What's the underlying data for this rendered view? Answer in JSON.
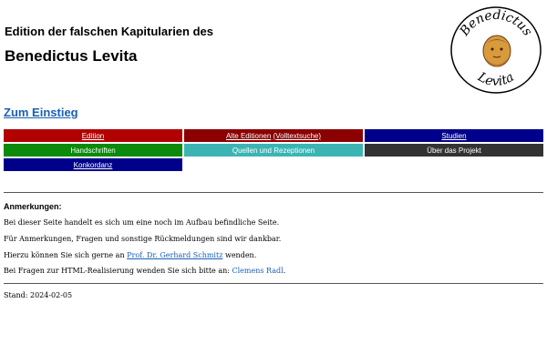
{
  "header": {
    "title_line1": "Edition der falschen Kapitularien des",
    "title_line2": "Benedictus Levita",
    "logo_text_top": "Benedictus",
    "logo_text_bottom": "Levita"
  },
  "entry_link": "Zum Einstieg",
  "nav": {
    "edition": "Edition",
    "alte_editionen": "Alte Editionen",
    "volltextsuche": "(Volltextsuche)",
    "studien": "Studien",
    "handschriften": "Handschriften",
    "quellen": "Quellen und Rezeptionen",
    "ueber": "Über das Projekt",
    "konkordanz": "Konkordanz"
  },
  "notes": {
    "title": "Anmerkungen:",
    "line1": "Bei dieser Seite handelt es sich um eine noch im Aufbau befindliche Seite.",
    "line2": "Für Anmerkungen, Fragen und sonstige Rückmeldungen sind wir dankbar.",
    "line3_prefix": "Hierzu können Sie sich gerne an ",
    "line3_link": "Prof. Dr. Gerhard Schmitz",
    "line3_suffix": " wenden.",
    "line4_prefix": "Bei Fragen zur HTML-Realisierung wenden Sie sich bitte an: ",
    "line4_link": "Clemens Radl",
    "line4_suffix": "."
  },
  "footer": {
    "stand": "Stand: 2024-02-05"
  },
  "colors": {
    "link": "#1a5fb4",
    "red": "#b30000",
    "darkred": "#8b0000",
    "navy": "#00008b",
    "green": "#0b8a0b",
    "teal": "#3cb4b4",
    "dark": "#333333"
  }
}
